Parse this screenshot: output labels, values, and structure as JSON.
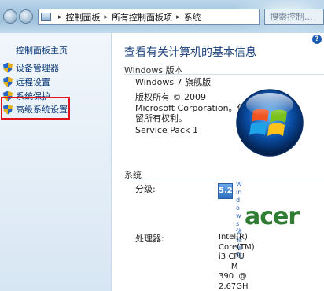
{
  "address_bar": {
    "crumbs": [
      "控制面板",
      "所有控制面板项",
      "系统"
    ],
    "search_placeholder": "搜索控制..."
  },
  "sidebar": {
    "home": "控制面板主页",
    "items": [
      {
        "label": "设备管理器",
        "icon": "shield-icon"
      },
      {
        "label": "远程设置",
        "icon": "shield-icon"
      },
      {
        "label": "系统保护",
        "icon": "shield-icon"
      },
      {
        "label": "高级系统设置",
        "icon": "shield-icon"
      }
    ]
  },
  "main": {
    "title": "查看有关计算机的基本信息",
    "help": "?",
    "windows_section": {
      "label": "Windows 版本",
      "edition": "Windows 7 旗舰版",
      "copyright_1": "版权所有 © 2009",
      "copyright_2": "Microsoft Corporation。保",
      "copyright_3": "留所有权利。",
      "service_pack": "Service Pack 1"
    },
    "system_section": {
      "label": "系统",
      "rating_label": "分级:",
      "rating_value": "5.2",
      "rating_link": "Windows体验指数",
      "processor_label": "处理器:",
      "processor_value": "Intel(R)\nCore(TM)\ni3 CPU\n     M\n390  @\n2.67GH"
    },
    "oem_logo": "acer"
  },
  "colors": {
    "link": "#0b3a78",
    "title": "#1a3f7a",
    "highlight": "#e0141a",
    "acer": "#2e7d32"
  }
}
